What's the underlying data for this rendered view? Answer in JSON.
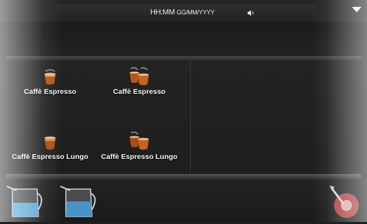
{
  "status": {
    "time_label": "HH:MM",
    "date_label": "GG/MM/YYYY"
  },
  "drinks": [
    {
      "label": "Caffè Espresso",
      "icon": "single-espresso-cup-icon"
    },
    {
      "label": "Caffè Espresso",
      "icon": "double-espresso-cups-icon"
    },
    {
      "label": "Caffè Espresso Lungo",
      "icon": "single-lungo-cup-icon"
    },
    {
      "label": "Caffè Espresso Lungo",
      "icon": "double-lungo-cups-icon"
    }
  ],
  "bottom_icons": [
    "milk-pitcher-icon",
    "hot-water-pitcher-icon",
    "steam-wand-icon"
  ],
  "colors": {
    "background": "#1f1f1f",
    "coffee": "#b5571d",
    "water": "#5aa6d9",
    "steam_button": "#c84a4a"
  }
}
